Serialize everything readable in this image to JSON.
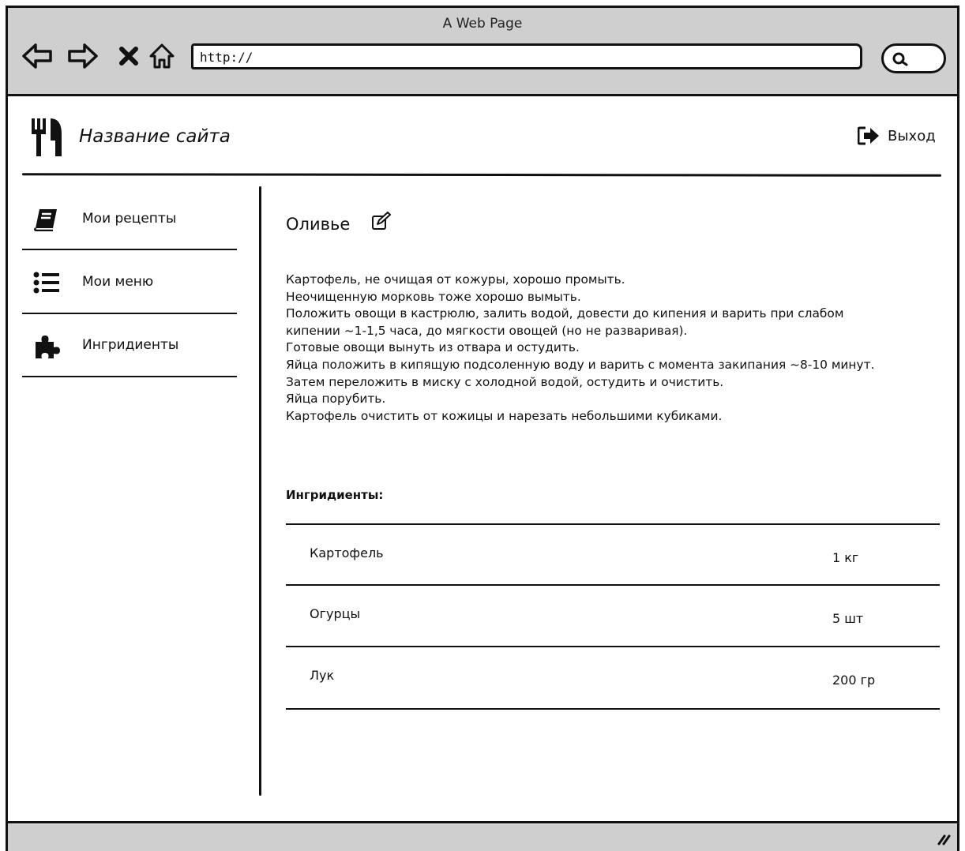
{
  "window": {
    "title": "A Web Page"
  },
  "browser": {
    "url": "http://"
  },
  "header": {
    "site_title": "Название сайта",
    "logout_label": "Выход"
  },
  "sidebar": {
    "items": [
      {
        "label": "Мои рецепты",
        "icon": "book-icon"
      },
      {
        "label": "Мои меню",
        "icon": "list-icon"
      },
      {
        "label": "Ингридиенты",
        "icon": "puzzle-icon"
      }
    ]
  },
  "recipe": {
    "title": "Оливье",
    "lines": [
      "Картофель, не очищая от кожуры, хорошо промыть.",
      "Неочищенную морковь тоже хорошо вымыть.",
      "Положить овощи в кастрюлю, залить водой, довести до кипения и варить при слабом",
      "кипении ~1-1,5 часа, до мягкости овощей (но не разваривая).",
      "Готовые овощи вынуть из отвара и остудить.",
      "Яйца положить в кипящую подсоленную воду и варить с момента закипания ~8-10 минут.",
      "Затем переложить в миску с холодной водой, остудить и очистить.",
      "Яйца порубить.",
      "Картофель очистить от кожицы и нарезать небольшими кубиками."
    ],
    "ingredients_heading": "Ингридиенты:",
    "ingredients": [
      {
        "name": "Картофель",
        "qty": "1 кг"
      },
      {
        "name": "Огурцы",
        "qty": "5 шт"
      },
      {
        "name": "Лук",
        "qty": "200 гр"
      }
    ]
  }
}
